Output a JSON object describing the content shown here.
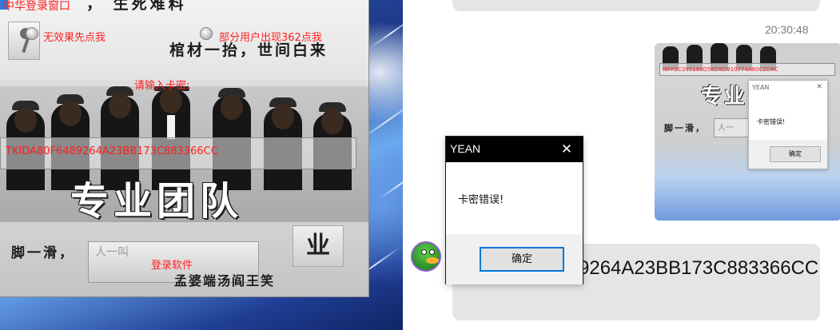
{
  "login_window": {
    "title": "中华登录窗口",
    "slogan_1": "，  生死难料",
    "slogan_2": "棺材一抬，世间白来",
    "btn_noeffect_label": "无效果先点我",
    "btn_users362_label": "部分用户出现362点我",
    "enter_card_label": "请输入卡密:",
    "card_input_value": "TKIDA80F6489264A23BB173C883366CC",
    "banner": "专业团队",
    "slip_text": "脚一滑，",
    "login_button_ghost": "人一叫",
    "login_button_label": "登录软件",
    "meng_text": "孟婆端汤阎王笑",
    "ye_tile": "业"
  },
  "chat": {
    "timestamp": "20:30:48",
    "thumbnail": {
      "card_input_value": "I8FF5C395169D58D8D910774A80C2D8C",
      "banner": "专业",
      "slip_text": "脚一滑，",
      "slip_box": "人一",
      "dialog_title": "YEAN",
      "dialog_close": "✕",
      "dialog_message": "卡密错误!",
      "dialog_ok": "确定"
    },
    "bottom_message_text": "9264A23BB173C883366CC"
  },
  "message_box": {
    "title": "YEAN",
    "close_glyph": "✕",
    "message": "卡密错误!",
    "ok_label": "确定",
    "accent_color": "#0078d7"
  },
  "icons": {
    "window_icon": "app-icon",
    "avatar": "green-duck-avatar"
  }
}
